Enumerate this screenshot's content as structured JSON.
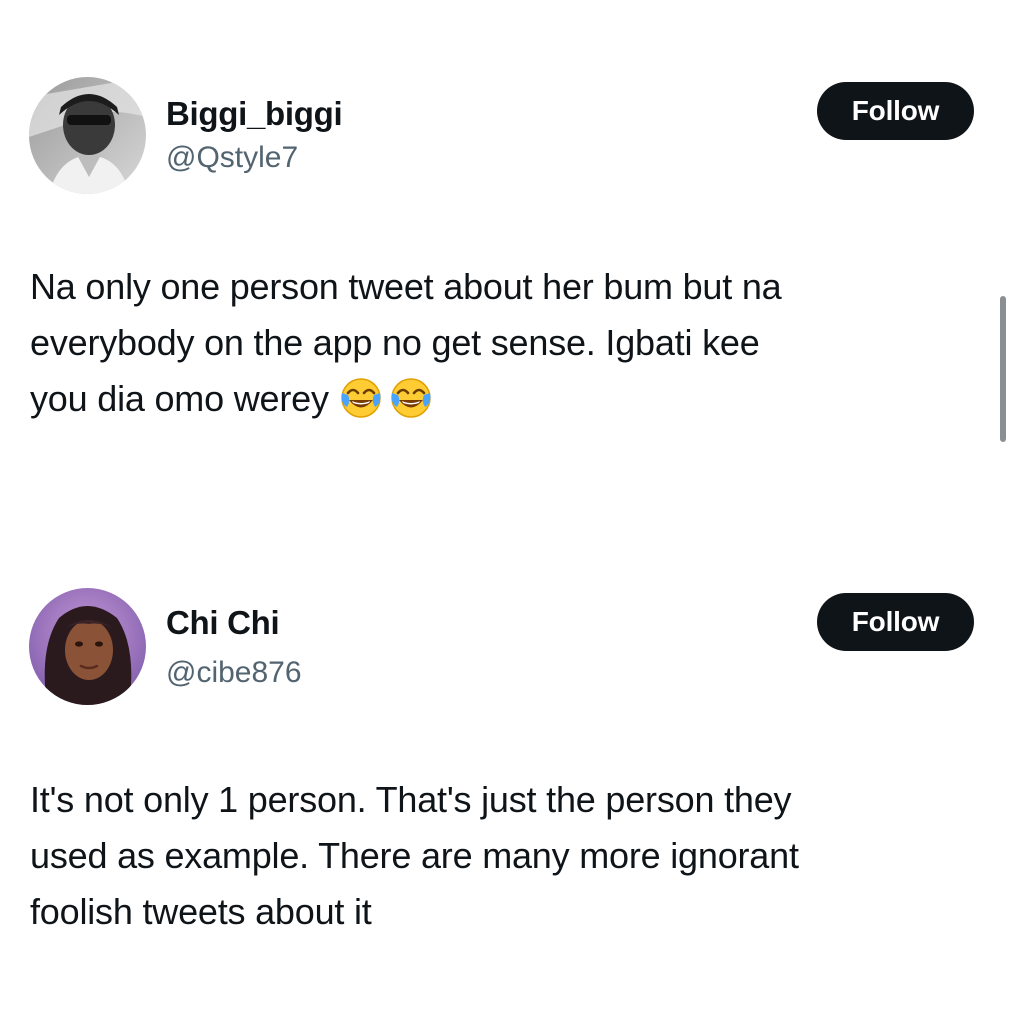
{
  "tweets": [
    {
      "display_name": "Biggi_biggi",
      "handle": "@Qstyle7",
      "follow_label": "Follow",
      "text_lines": [
        "Na only one person tweet about her bum but na",
        "everybody on the app no get sense. Igbati kee",
        "you dia omo werey"
      ],
      "emojis": [
        "face-with-tears-of-joy-icon",
        "face-with-tears-of-joy-icon"
      ]
    },
    {
      "display_name": "Chi Chi",
      "handle": "@cibe876",
      "follow_label": "Follow",
      "text_lines": [
        "It's not only 1 person. That's just the person they",
        "used as example. There are many more ignorant",
        "foolish tweets about it"
      ]
    }
  ],
  "colors": {
    "text_primary": "#0f1419",
    "text_secondary": "#536471",
    "follow_bg": "#0f1419",
    "follow_text": "#ffffff",
    "scrollbar": "#8a8f94"
  }
}
